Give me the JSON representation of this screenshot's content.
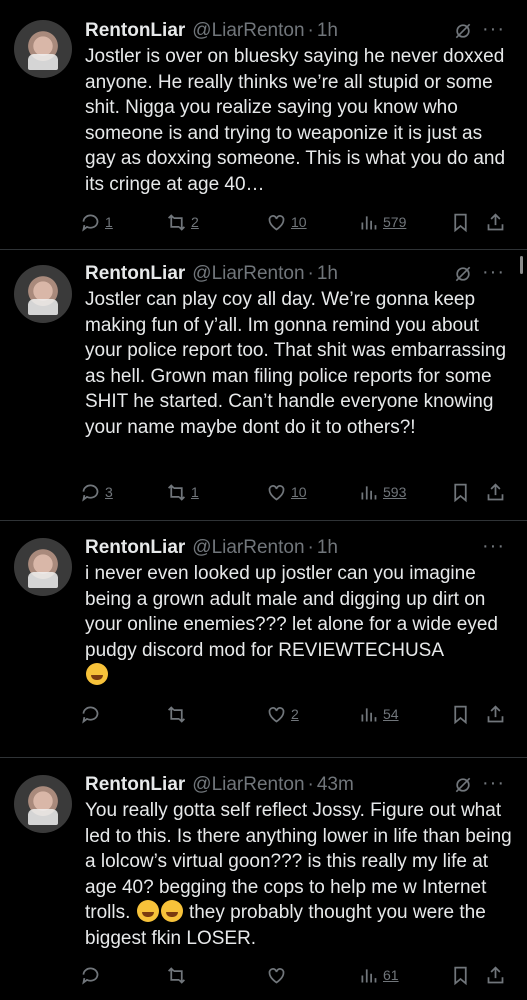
{
  "tweets": [
    {
      "name": "RentonLiar",
      "handle": "@LiarRenton",
      "time": "1h",
      "text": "Jostler is over on bluesky saying he never doxxed anyone. He really thinks we’re all stupid or some shit. Nigga you realize saying you know who someone is and trying to weaponize it is just as gay as doxxing someone. This is what you do and its cringe at age 40…",
      "replies": "1",
      "reposts": "2",
      "likes": "10",
      "views": "579"
    },
    {
      "name": "RentonLiar",
      "handle": "@LiarRenton",
      "time": "1h",
      "text": "Jostler can play coy all day. We’re gonna keep making fun of y’all. Im gonna remind you about your police report too. That shit was embarrassing as hell. Grown man filing police reports for some SHIT he started. Can’t handle everyone knowing your name maybe dont do it to others?!",
      "replies": "3",
      "reposts": "1",
      "likes": "10",
      "views": "593"
    },
    {
      "name": "RentonLiar",
      "handle": "@LiarRenton",
      "time": "1h",
      "text": "i never even looked up jostler can you imagine being a grown adult male and digging up dirt on your online enemies??? let alone for a wide eyed pudgy discord mod for REVIEWTECHUSA",
      "replies": "",
      "reposts": "",
      "likes": "2",
      "views": "54"
    },
    {
      "name": "RentonLiar",
      "handle": "@LiarRenton",
      "time": "43m",
      "text": "You really gotta self reflect Jossy. Figure out what led to this. Is there anything lower in life than being a lolcow’s virtual goon??? is this really my life at age 40? begging the cops to help me w Internet trolls.",
      "text_end": " they probably thought you were the biggest fkin LOSER.",
      "replies": "",
      "reposts": "",
      "likes": "",
      "views": "61"
    }
  ],
  "colors": {
    "background": "#000000",
    "text": "#e7e9ea",
    "secondary": "#71767b",
    "divider": "#2f3336"
  },
  "icons": [
    "reply-icon",
    "repost-icon",
    "like-icon",
    "views-icon",
    "bookmark-icon",
    "share-icon",
    "grok-icon",
    "more-icon",
    "emoji-laughing"
  ]
}
